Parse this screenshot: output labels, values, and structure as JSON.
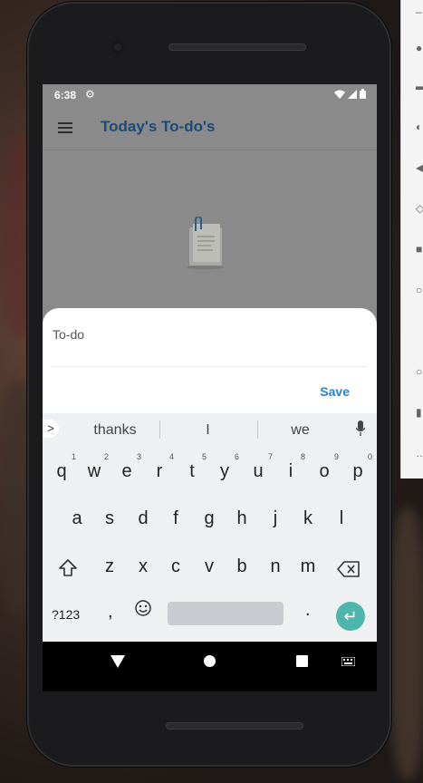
{
  "status_bar": {
    "time": "6:38"
  },
  "app_bar": {
    "title": "Today's To-do's"
  },
  "sheet": {
    "input_placeholder": "To-do",
    "save_label": "Save"
  },
  "keyboard": {
    "suggestions": [
      "thanks",
      "I",
      "we"
    ],
    "row1": [
      {
        "key": "q",
        "hint": "1"
      },
      {
        "key": "w",
        "hint": "2"
      },
      {
        "key": "e",
        "hint": "3"
      },
      {
        "key": "r",
        "hint": "4"
      },
      {
        "key": "t",
        "hint": "5"
      },
      {
        "key": "y",
        "hint": "6"
      },
      {
        "key": "u",
        "hint": "7"
      },
      {
        "key": "i",
        "hint": "8"
      },
      {
        "key": "o",
        "hint": "9"
      },
      {
        "key": "p",
        "hint": "0"
      }
    ],
    "row2": [
      "a",
      "s",
      "d",
      "f",
      "g",
      "h",
      "j",
      "k",
      "l"
    ],
    "row3": [
      "z",
      "x",
      "c",
      "v",
      "b",
      "n",
      "m"
    ],
    "symbols_label": "?123",
    "comma_label": ",",
    "period_label": "."
  },
  "colors": {
    "title": "#1d4a78",
    "save": "#2a7fd6",
    "enter": "#4db6ac",
    "scrim": "#8a8a8a"
  },
  "icons": {
    "menu": "menu-icon",
    "settings": "gear-icon",
    "wifi": "wifi-icon",
    "signal": "signal-icon",
    "battery": "battery-icon",
    "mic": "mic-icon",
    "shift": "shift-icon",
    "backspace": "backspace-icon",
    "emoji": "emoji-icon",
    "enter": "enter-icon",
    "back": "back-icon",
    "home": "home-icon",
    "recents": "recents-icon"
  }
}
